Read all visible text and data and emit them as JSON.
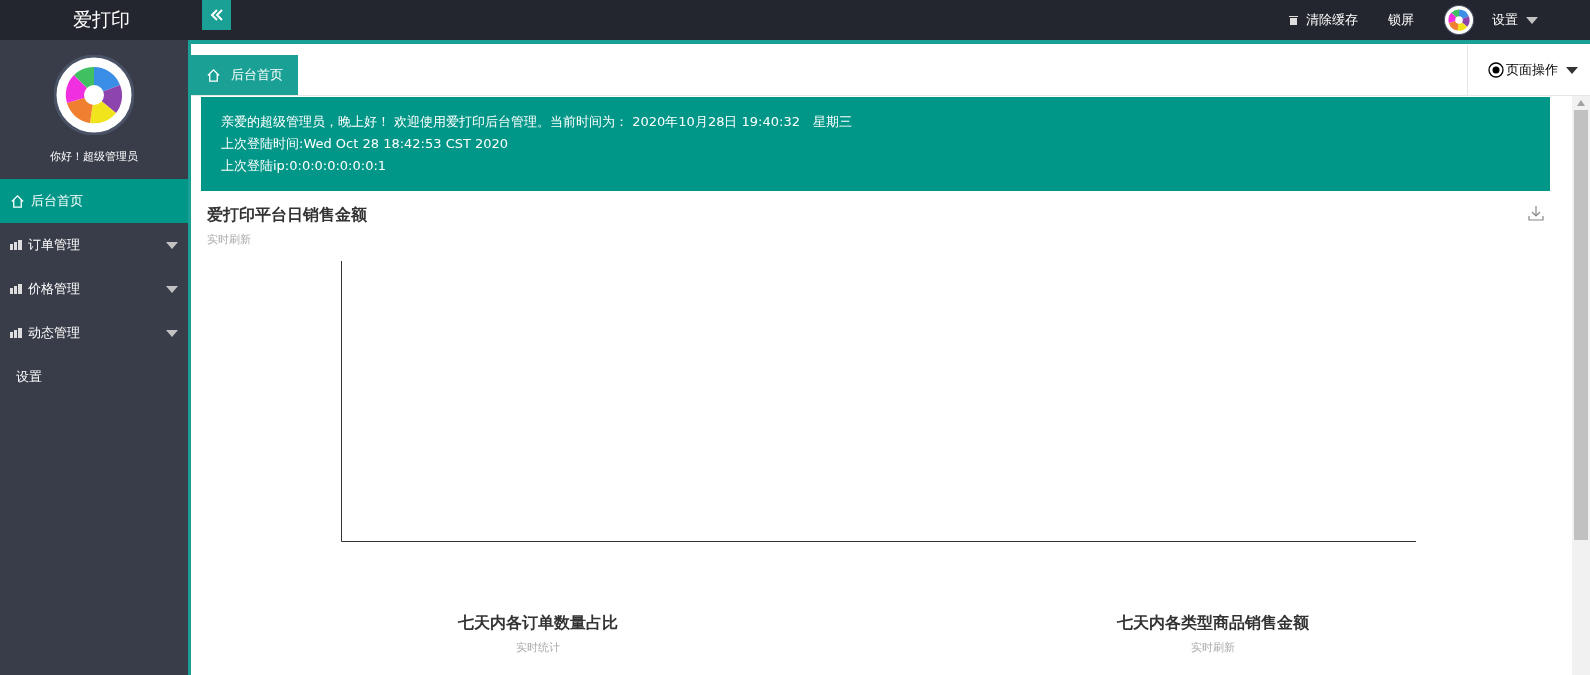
{
  "header": {
    "logo": "爱打印",
    "actions": [
      {
        "kind": "trash",
        "label": "清除缓存"
      },
      {
        "kind": "plain",
        "label": "锁屏"
      },
      {
        "kind": "user",
        "label": "设置"
      }
    ]
  },
  "sidebar": {
    "greeting": "你好！超级管理员",
    "items": [
      {
        "label": "后台首页",
        "kind": "home",
        "selected": true
      },
      {
        "label": "订单管理",
        "kind": "group",
        "selected": false
      },
      {
        "label": "价格管理",
        "kind": "group",
        "selected": false
      },
      {
        "label": "动态管理",
        "kind": "group",
        "selected": false
      },
      {
        "label": "设置",
        "kind": "plain",
        "selected": false
      }
    ]
  },
  "tabs": [
    {
      "label": "后台首页",
      "selected": true
    }
  ],
  "page_actions": "页面操作",
  "banner": [
    "亲爱的超级管理员，晚上好！ 欢迎使用爱打印后台管理。当前时间为： 2020年10月28日 19:40:32　星期三",
    "上次登陆时间:Wed Oct 28 18:42:53 CST 2020",
    "上次登陆ip:0:0:0:0:0:0:0:1"
  ],
  "sales_chart": {
    "title": "爱打印平台日销售金额",
    "subtitle": "实时刷新"
  },
  "bottom_charts": [
    {
      "title": "七天内各订单数量占比",
      "subtitle": "实时统计"
    },
    {
      "title": "七天内各类型商品销售金额",
      "subtitle": "实时刷新"
    }
  ]
}
